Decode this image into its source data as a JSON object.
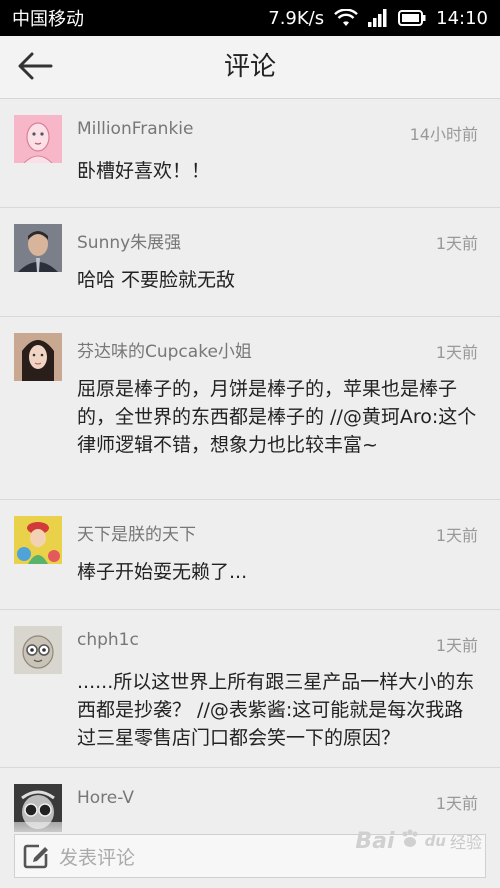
{
  "status_bar": {
    "carrier": "中国移动",
    "speed": "7.9K/s",
    "time": "14:10"
  },
  "header": {
    "title": "评论",
    "back_icon": "arrow-left-icon"
  },
  "comments": [
    {
      "name": "MillionFrankie",
      "time": "14小时前",
      "text": "卧槽好喜欢！！"
    },
    {
      "name": "Sunny朱展强",
      "time": "1天前",
      "text": "哈哈 不要脸就无敌"
    },
    {
      "name": "芬达味的Cupcake小姐",
      "time": "1天前",
      "text": "屈原是棒子的，月饼是棒子的，苹果也是棒子的，全世界的东西都是棒子的 //@黄珂Aro:这个律师逻辑不错，想象力也比较丰富~"
    },
    {
      "name": "天下是朕的天下",
      "time": "1天前",
      "text": "棒子开始耍无赖了..."
    },
    {
      "name": "chph1c",
      "time": "1天前",
      "text": "......所以这世界上所有跟三星产品一样大小的东西都是抄袭？ //@表紫酱:这可能就是每次我路过三星零售店门口都会笑一下的原因？"
    },
    {
      "name": "Hore-V",
      "time": "1天前",
      "text": ""
    }
  ],
  "compose": {
    "placeholder": "发表评论",
    "icon": "edit-icon"
  },
  "watermark": {
    "brand": "Bai",
    "paw": "du",
    "text": "经验"
  }
}
